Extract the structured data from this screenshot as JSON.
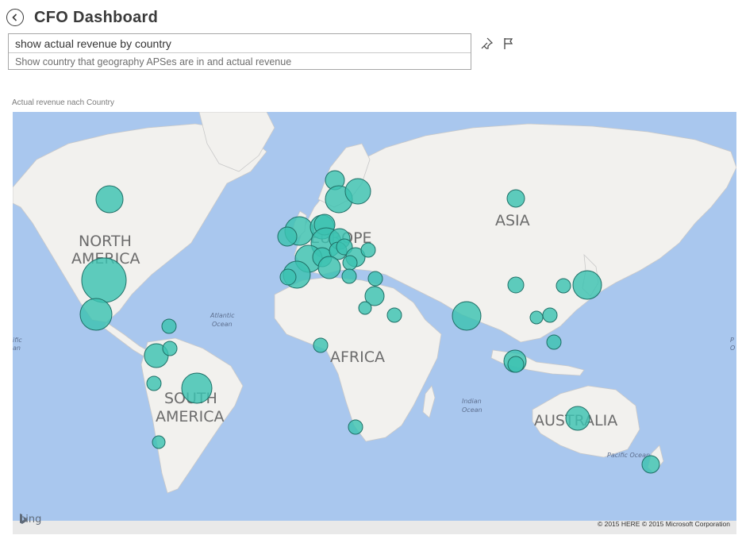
{
  "header": {
    "title": "CFO Dashboard"
  },
  "qa": {
    "input_value": "show actual revenue by country",
    "suggestion": "Show country that geography APSes are in and actual revenue"
  },
  "chart": {
    "title": "Actual revenue nach Country",
    "map_labels": {
      "north_america": [
        "NORTH",
        "AMERICA"
      ],
      "south_america": [
        "SOUTH",
        "AMERICA"
      ],
      "europe": "EUROPE",
      "africa": "AFRICA",
      "asia": "ASIA",
      "australia": "AUSTRALIA"
    },
    "ocean_labels": {
      "atlantic": [
        "Atlantic",
        "Ocean"
      ],
      "indian": [
        "Indian",
        "Ocean"
      ],
      "pacific_east": "Pacific Ocean",
      "pacific_west_1": "ific",
      "pacific_west_2": "an",
      "pacific_right_1": "P",
      "pacific_right_2": "O"
    },
    "attribution": {
      "logo": "bing",
      "copyright": "© 2015 HERE   © 2015 Microsoft Corporation"
    }
  },
  "colors": {
    "bubble": "#3cc2b1",
    "water": "#a9c7ee",
    "land": "#f2f1ee"
  },
  "icons": {
    "back": "back-arrow-icon",
    "pin": "pin-icon",
    "flag": "flag-icon"
  }
}
